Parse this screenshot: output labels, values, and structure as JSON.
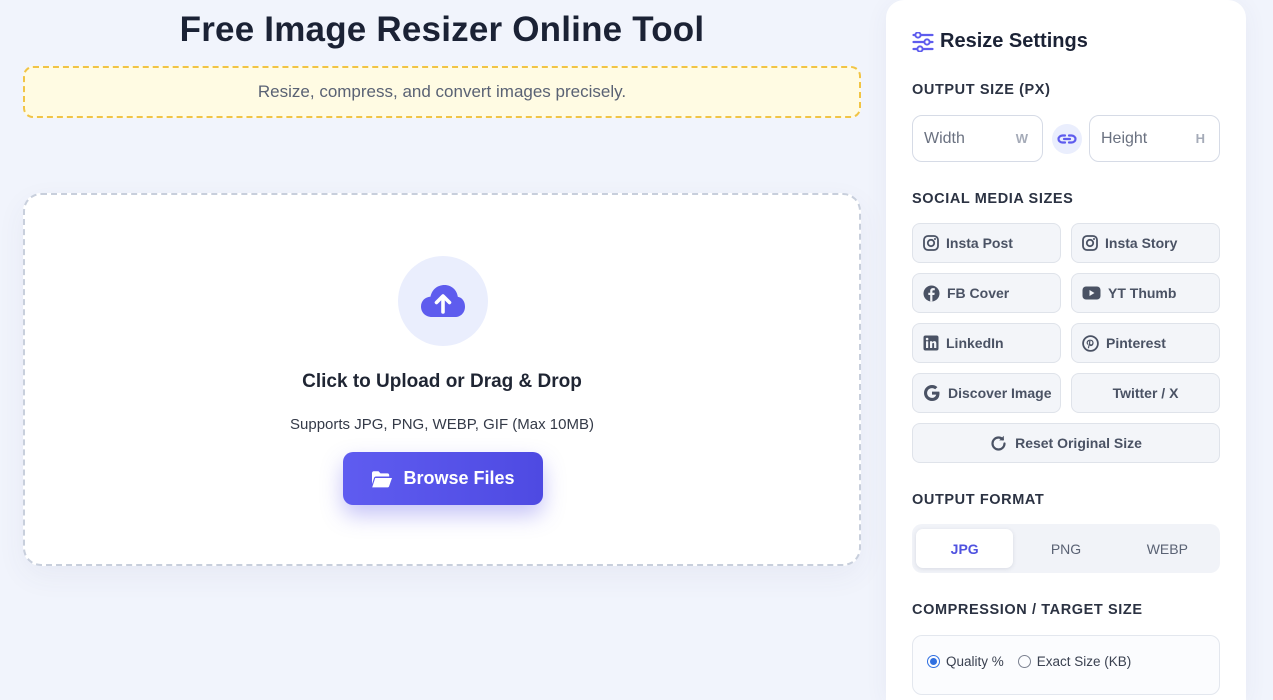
{
  "header": {
    "title": "Free Image Resizer Online Tool",
    "banner": "Resize, compress, and convert images precisely."
  },
  "upload": {
    "icon": "cloud-upload-icon",
    "title": "Click to Upload or Drag & Drop",
    "subtitle": "Supports JPG, PNG, WEBP, GIF (Max 10MB)",
    "browse_label": "Browse Files"
  },
  "sidebar": {
    "title": "Resize Settings",
    "output_size_label": "OUTPUT SIZE (PX)",
    "width": {
      "placeholder": "Width",
      "value": "",
      "suffix": "W"
    },
    "height": {
      "placeholder": "Height",
      "value": "",
      "suffix": "H"
    },
    "social_label": "SOCIAL MEDIA SIZES",
    "presets": [
      {
        "label": "Insta Post",
        "icon": "instagram-icon"
      },
      {
        "label": "Insta Story",
        "icon": "instagram-icon"
      },
      {
        "label": "FB Cover",
        "icon": "facebook-icon"
      },
      {
        "label": "YT Thumb",
        "icon": "youtube-icon"
      },
      {
        "label": "LinkedIn",
        "icon": "linkedin-icon"
      },
      {
        "label": "Pinterest",
        "icon": "pinterest-icon"
      },
      {
        "label": "Discover Image",
        "icon": "google-icon"
      },
      {
        "label": "Twitter / X",
        "icon": ""
      }
    ],
    "reset_label": "Reset Original Size",
    "format_label": "OUTPUT FORMAT",
    "formats": [
      "JPG",
      "PNG",
      "WEBP"
    ],
    "selected_format": "JPG",
    "compression_label": "COMPRESSION / TARGET SIZE",
    "compression_modes": [
      "Quality %",
      "Exact Size (KB)"
    ],
    "selected_mode": "Quality %"
  },
  "colors": {
    "accent": "#5b58ed",
    "banner_bg": "#fffbe3",
    "banner_border": "#f1c445",
    "page_bg": "#f1f4fc"
  }
}
